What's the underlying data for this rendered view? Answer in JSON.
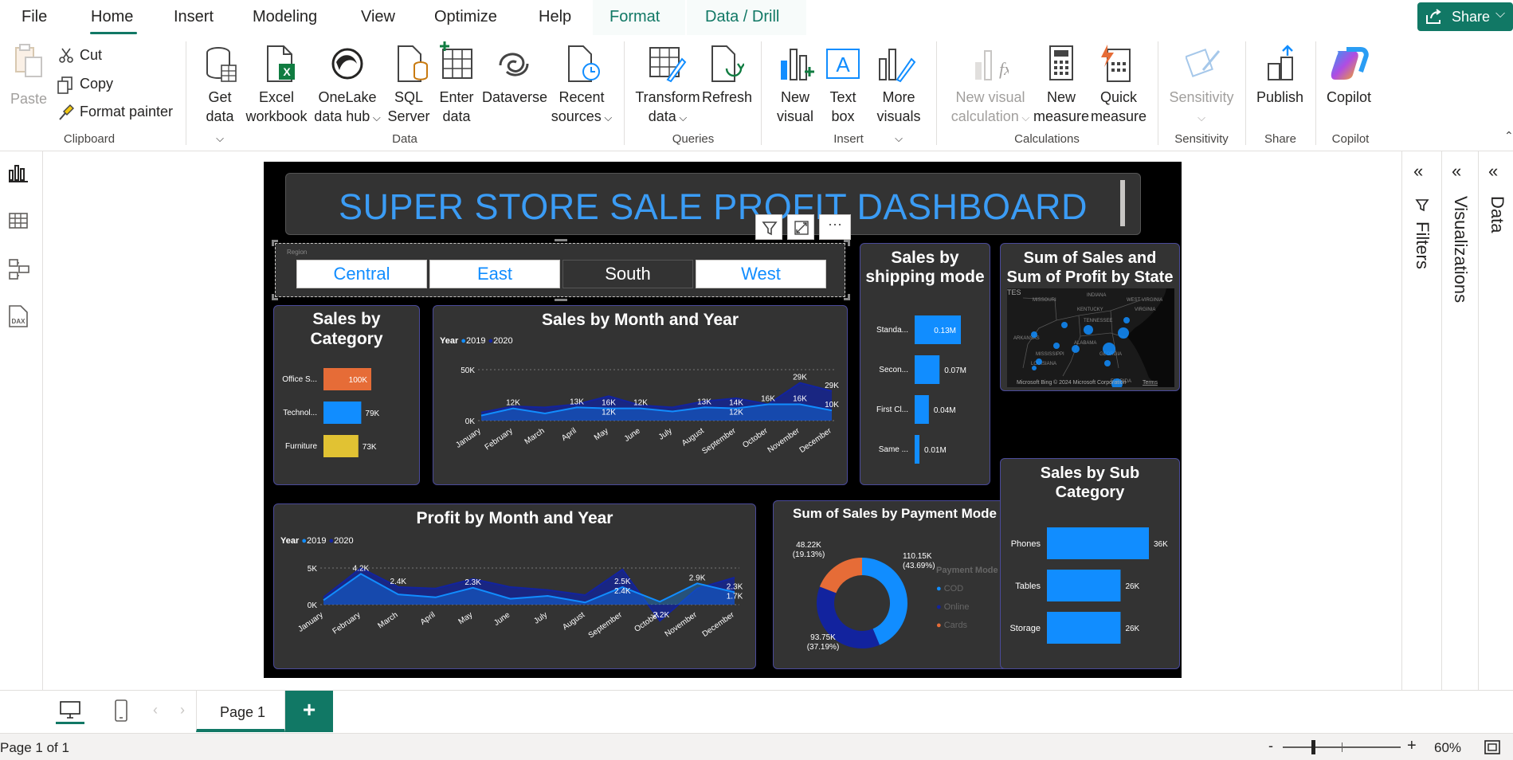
{
  "menubar": {
    "items": [
      "File",
      "Home",
      "Insert",
      "Modeling",
      "View",
      "Optimize",
      "Help"
    ],
    "context_tabs": [
      "Format",
      "Data / Drill"
    ],
    "share_label": "Share"
  },
  "ribbon": {
    "clipboard": {
      "paste": "Paste",
      "cut": "Cut",
      "copy": "Copy",
      "format_painter": "Format painter",
      "group": "Clipboard"
    },
    "data": {
      "get_data_1": "Get",
      "get_data_2": "data",
      "excel_1": "Excel",
      "excel_2": "workbook",
      "onelake_1": "OneLake",
      "onelake_2": "data hub",
      "sql_1": "SQL",
      "sql_2": "Server",
      "enter_1": "Enter",
      "enter_2": "data",
      "dataverse": "Dataverse",
      "recent_1": "Recent",
      "recent_2": "sources",
      "group": "Data"
    },
    "queries": {
      "transform_1": "Transform",
      "transform_2": "data",
      "refresh": "Refresh",
      "group": "Queries"
    },
    "insert": {
      "new_visual_1": "New",
      "new_visual_2": "visual",
      "text_box_1": "Text",
      "text_box_2": "box",
      "more_1": "More",
      "more_2": "visuals",
      "group": "Insert"
    },
    "calculations": {
      "nvc_1": "New visual",
      "nvc_2": "calculation",
      "nm_1": "New",
      "nm_2": "measure",
      "qm_1": "Quick",
      "qm_2": "measure",
      "group": "Calculations"
    },
    "sensitivity": {
      "label": "Sensitivity",
      "group": "Sensitivity"
    },
    "share": {
      "publish": "Publish",
      "group": "Share"
    },
    "copilot": {
      "label": "Copilot",
      "group": "Copilot"
    }
  },
  "report": {
    "title": "SUPER STORE SALE PROFIT DASHBOARD",
    "slicer": {
      "header": "Region",
      "options": [
        "Central",
        "East",
        "South",
        "West"
      ],
      "selected": "South"
    },
    "category": {
      "title_1": "Sales by",
      "title_2": "Category"
    },
    "month_sales": {
      "title": "Sales by Month and Year",
      "legend_title": "Year",
      "legend": [
        "2019",
        "2020"
      ]
    },
    "shipping": {
      "title_1": "Sales by",
      "title_2": "shipping mode"
    },
    "map": {
      "title_1": "Sum of Sales and",
      "title_2": "Sum of Profit by State",
      "attrib": "Microsoft Bing",
      "copyright": "© 2024 Microsoft Corporation",
      "terms": "Terms",
      "fragment": "TES",
      "states": [
        "MISSOURI",
        "INDIANA",
        "WEST VIRGINIA",
        "KENTUCKY",
        "VIRGINIA",
        "TENNESSEE",
        "ARKANSAS",
        "ALABAMA",
        "MISSISSIPPI",
        "GEORGIA",
        "LOUISIANA",
        "FLORIDA"
      ]
    },
    "profit": {
      "title": "Profit by Month and Year",
      "legend_title": "Year",
      "legend": [
        "2019",
        "2020"
      ]
    },
    "payment": {
      "title": "Sum of Sales by Payment Mode",
      "legend_title": "Payment Mode",
      "legend": [
        "COD",
        "Online",
        "Cards"
      ],
      "labels": [
        {
          "v": "110.15K",
          "p": "(43.69%)"
        },
        {
          "v": "93.75K",
          "p": "(37.19%)"
        },
        {
          "v": "48.22K",
          "p": "(19.13%)"
        }
      ]
    },
    "subcat": {
      "title_1": "Sales by Sub",
      "title_2": "Category"
    }
  },
  "colors": {
    "accent": "#117865",
    "bar_blue": "#118dff",
    "bar_orange": "#e66c37",
    "bar_yellow": "#e1c233",
    "dark_blue": "#12239e",
    "title_blue": "#3b9cf5"
  },
  "chart_data": [
    {
      "type": "bar",
      "title": "Sales by Category",
      "categories": [
        "Office S...",
        "Technol...",
        "Furniture"
      ],
      "values": [
        100,
        79,
        73
      ],
      "value_labels": [
        "100K",
        "79K",
        "73K"
      ],
      "colors": [
        "#e66c37",
        "#118dff",
        "#e1c233"
      ]
    },
    {
      "type": "area",
      "title": "Sales by Month and Year",
      "categories": [
        "January",
        "February",
        "March",
        "April",
        "May",
        "June",
        "July",
        "August",
        "September",
        "October",
        "November",
        "December"
      ],
      "yticks": [
        "0K",
        "50K"
      ],
      "ylim": [
        0,
        50
      ],
      "series": [
        {
          "name": "2019",
          "values": [
            5,
            12,
            7,
            13,
            12,
            12,
            9,
            13,
            12,
            16,
            16,
            10
          ]
        },
        {
          "name": "2020",
          "values": [
            8,
            14,
            13,
            16,
            24,
            15,
            13,
            19,
            22,
            16,
            37,
            29
          ]
        }
      ],
      "data_labels": [
        {
          "x": "February",
          "text": "12K"
        },
        {
          "x": "April",
          "text": "13K"
        },
        {
          "x": "May",
          "text": "16K"
        },
        {
          "x": "May",
          "text": "12K"
        },
        {
          "x": "June",
          "text": "12K"
        },
        {
          "x": "August",
          "text": "13K"
        },
        {
          "x": "September",
          "text": "14K"
        },
        {
          "x": "September",
          "text": "12K"
        },
        {
          "x": "October",
          "text": "16K"
        },
        {
          "x": "November",
          "text": "29K"
        },
        {
          "x": "November",
          "text": "16K"
        },
        {
          "x": "December",
          "text": "29K"
        },
        {
          "x": "December",
          "text": "10K"
        }
      ]
    },
    {
      "type": "bar",
      "title": "Sales by shipping mode",
      "categories": [
        "Standa...",
        "Secon...",
        "First Cl...",
        "Same ..."
      ],
      "values": [
        0.13,
        0.07,
        0.04,
        0.01
      ],
      "value_labels": [
        "0.13M",
        "0.07M",
        "0.04M",
        "0.01M"
      ]
    },
    {
      "type": "area",
      "title": "Profit by Month and Year",
      "categories": [
        "January",
        "February",
        "March",
        "April",
        "May",
        "June",
        "July",
        "August",
        "September",
        "October",
        "November",
        "December"
      ],
      "yticks": [
        "0K",
        "5K"
      ],
      "ylim": [
        -3,
        5
      ],
      "series": [
        {
          "name": "2019",
          "values": [
            0.6,
            4.2,
            1.4,
            1.0,
            2.3,
            0.8,
            1.2,
            0.3,
            2.4,
            0.4,
            2.9,
            1.7
          ]
        },
        {
          "name": "2020",
          "values": [
            1.0,
            5.0,
            2.4,
            2.2,
            3.5,
            2.4,
            2.0,
            1.3,
            4.8,
            -2.2,
            2.2,
            3.7
          ]
        }
      ],
      "data_labels": [
        {
          "x": "February",
          "text": "4.2K"
        },
        {
          "x": "March",
          "text": "2.4K"
        },
        {
          "x": "May",
          "text": "2.3K"
        },
        {
          "x": "September",
          "text": "2.5K"
        },
        {
          "x": "September",
          "text": "2.4K"
        },
        {
          "x": "October",
          "text": "-2.2K"
        },
        {
          "x": "November",
          "text": "2.9K"
        },
        {
          "x": "December",
          "text": "2.3K"
        },
        {
          "x": "December",
          "text": "1.7K"
        }
      ]
    },
    {
      "type": "pie",
      "title": "Sum of Sales by Payment Mode",
      "categories": [
        "COD",
        "Online",
        "Cards"
      ],
      "values": [
        110.15,
        93.75,
        48.22
      ],
      "colors": [
        "#118dff",
        "#12239e",
        "#e66c37"
      ]
    },
    {
      "type": "bar",
      "title": "Sales by Sub Category",
      "categories": [
        "Phones",
        "Tables",
        "Storage"
      ],
      "values": [
        36,
        26,
        26
      ],
      "value_labels": [
        "36K",
        "26K",
        "26K"
      ]
    }
  ],
  "panes": {
    "filters": "Filters",
    "visualizations": "Visualizations",
    "data": "Data"
  },
  "pages": {
    "tab": "Page 1",
    "add": "+"
  },
  "status": {
    "page": "Page 1 of 1",
    "zoom": "60%",
    "minus": "-",
    "plus": "+"
  }
}
